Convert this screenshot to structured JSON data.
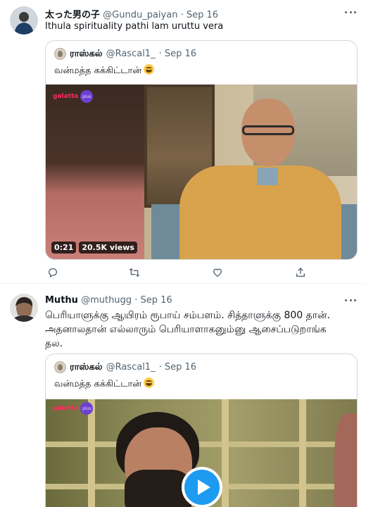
{
  "tweets": [
    {
      "name": "太った男の子",
      "handle": "@Gundu_paiyan",
      "date": "· Sep 16",
      "text": "Ithula spirituality pathi lam uruttu vera",
      "quote": {
        "name": "ராஸ்கல்",
        "handle": "@Rascal1_",
        "date": "· Sep 16",
        "text": "வன்மத்த கக்கிட்டான்",
        "video": {
          "logo": "galatta",
          "logo_badge": "plus",
          "duration": "0:21",
          "views": "20.5K views"
        }
      }
    },
    {
      "name": "Muthu",
      "handle": "@muthugg",
      "date": "· Sep 16",
      "text": "பெரியாளுக்கு ஆயிரம் ரூபாய் சம்பளம். சித்தாளுக்கு 800 தான். அதனாலதான் எல்லாரும் பெரியாளாகனும்னு ஆசைப்படுறாங்க தல.",
      "quote": {
        "name": "ராஸ்கல்",
        "handle": "@Rascal1_",
        "date": "· Sep 16",
        "text": "வன்மத்த கக்கிட்டான்",
        "video": {
          "logo": "galatta",
          "logo_badge": "plus"
        }
      }
    }
  ],
  "icons": {
    "reply": "reply-icon",
    "retweet": "retweet-icon",
    "like": "like-icon",
    "share": "share-icon",
    "more": "more-icon",
    "play": "play-icon",
    "emoji": "joy-emoji-icon"
  },
  "colors": {
    "text": "#0f1419",
    "secondary": "#536471",
    "border": "#cfd9de",
    "accent": "#1d9bf0"
  }
}
